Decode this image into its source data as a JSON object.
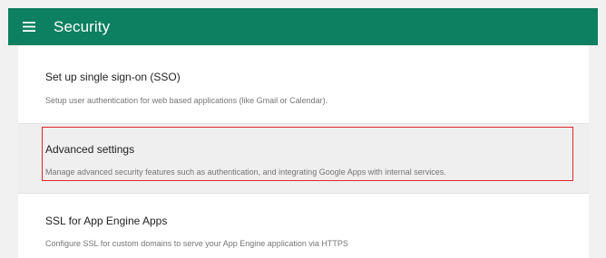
{
  "app": {
    "title": "Security",
    "menu_icon": "hamburger-menu-icon",
    "header_color": "#0c8060"
  },
  "settings": [
    {
      "title": "Set up single sign-on (SSO)",
      "description": "Setup user authentication for web based applications (like Gmail or Calendar)."
    },
    {
      "title": "Advanced settings",
      "description": "Manage advanced security features such as authentication, and integrating Google Apps with internal services.",
      "highlighted": true,
      "highlight_color": "#e0242b"
    },
    {
      "title": "SSL for App Engine Apps",
      "description": "Configure SSL for custom domains to serve your App Engine application via HTTPS"
    }
  ]
}
